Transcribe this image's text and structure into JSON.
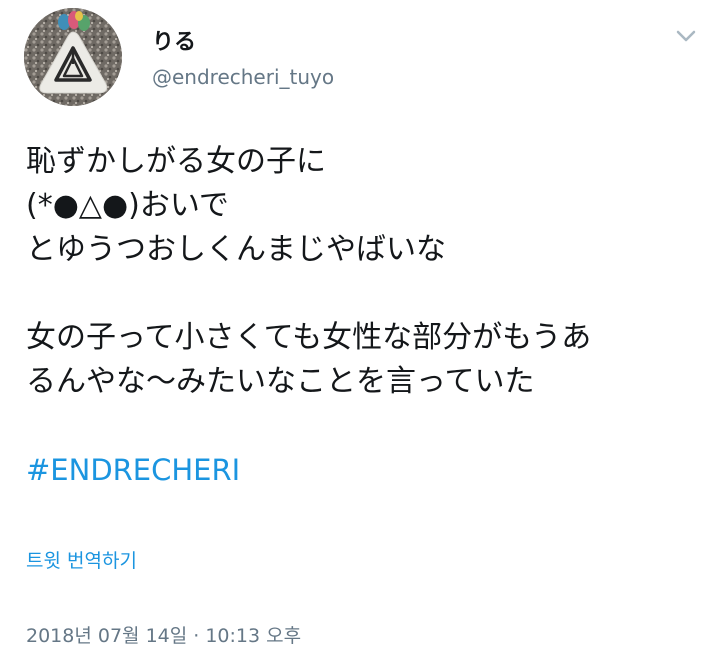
{
  "user": {
    "display_name": "りる",
    "screen_name": "@endrecheri_tuyo",
    "avatar_icon": "triangle-logo-stone-avatar"
  },
  "menu": {
    "caret_icon": "chevron-down-icon"
  },
  "tweet": {
    "lines": [
      "恥ずかしがる女の子に",
      "(*●△●)おいで",
      "とゆうつおしくんまじやばいな",
      "",
      "女の子って小さくても女性な部分がもうあ",
      "るんやな〜みたいなことを言っていた"
    ],
    "hashtag": "#ENDRECHERI",
    "translate_label": "트윗 번역하기",
    "timestamp": "2018년 07월 14일 · 10:13 오후"
  },
  "colors": {
    "link": "#1b95e0",
    "secondary_text": "#657786",
    "primary_text": "#14171a"
  }
}
